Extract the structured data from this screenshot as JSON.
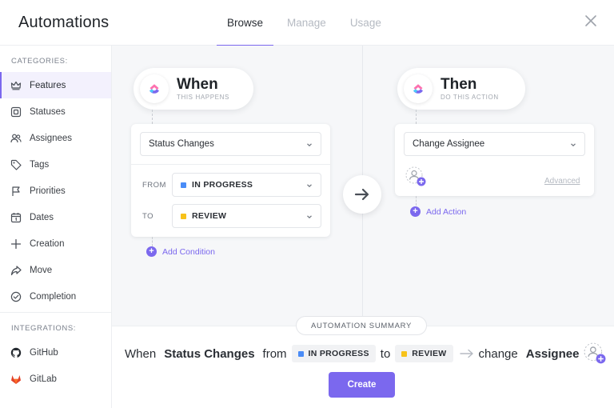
{
  "header": {
    "title": "Automations",
    "tabs": [
      {
        "label": "Browse",
        "active": true
      },
      {
        "label": "Manage",
        "active": false
      },
      {
        "label": "Usage",
        "active": false
      }
    ],
    "close_icon": "close-icon"
  },
  "sidebar": {
    "categories_label": "CATEGORIES:",
    "categories": [
      {
        "label": "Features",
        "icon": "crown-icon",
        "active": true
      },
      {
        "label": "Statuses",
        "icon": "status-square-icon"
      },
      {
        "label": "Assignees",
        "icon": "users-icon"
      },
      {
        "label": "Tags",
        "icon": "tag-icon"
      },
      {
        "label": "Priorities",
        "icon": "flag-icon"
      },
      {
        "label": "Dates",
        "icon": "calendar-icon"
      },
      {
        "label": "Creation",
        "icon": "plus-icon"
      },
      {
        "label": "Move",
        "icon": "share-arrow-icon"
      },
      {
        "label": "Completion",
        "icon": "check-circle-icon"
      }
    ],
    "integrations_label": "INTEGRATIONS:",
    "integrations": [
      {
        "label": "GitHub",
        "icon": "github-icon"
      },
      {
        "label": "GitLab",
        "icon": "gitlab-icon"
      }
    ]
  },
  "when": {
    "title": "When",
    "subtitle": "THIS HAPPENS",
    "trigger": "Status Changes",
    "from_label": "FROM",
    "from_value": "IN PROGRESS",
    "to_label": "TO",
    "to_value": "REVIEW",
    "add_condition": "Add Condition"
  },
  "then": {
    "title": "Then",
    "subtitle": "DO THIS ACTION",
    "action": "Change Assignee",
    "advanced": "Advanced",
    "add_action": "Add Action"
  },
  "summary": {
    "badge": "AUTOMATION SUMMARY",
    "when_word": "When",
    "trigger": "Status Changes",
    "from_word": "from",
    "from_chip": "IN PROGRESS",
    "to_word": "to",
    "to_chip": "REVIEW",
    "change_word": "change",
    "target": "Assignee",
    "create_label": "Create"
  },
  "colors": {
    "accent": "#7b68ee",
    "in_progress": "#4a8cf7",
    "review": "#f7c21a",
    "gitlab": "#e2432a"
  }
}
